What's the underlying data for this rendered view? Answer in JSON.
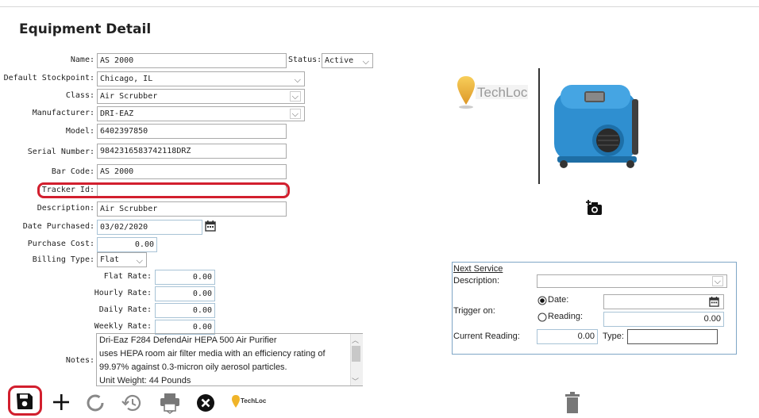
{
  "page_title": "Equipment Detail",
  "fields": {
    "name": {
      "label": "Name:",
      "value": "AS 2000"
    },
    "status": {
      "label": "Status:",
      "value": "Active"
    },
    "default_stockpoint": {
      "label": "Default Stockpoint:",
      "value": "Chicago, IL"
    },
    "class": {
      "label": "Class:",
      "value": "Air Scrubber"
    },
    "manufacturer": {
      "label": "Manufacturer:",
      "value": "DRI-EAZ"
    },
    "model": {
      "label": "Model:",
      "value": "6402397850"
    },
    "serial_number": {
      "label": "Serial Number:",
      "value": "9842316583742118DRZ"
    },
    "bar_code": {
      "label": "Bar Code:",
      "value": "AS 2000"
    },
    "tracker_id": {
      "label": "Tracker Id:",
      "value": ""
    },
    "description": {
      "label": "Description:",
      "value": "Air Scrubber"
    },
    "date_purchased": {
      "label": "Date Purchased:",
      "value": "03/02/2020"
    },
    "purchase_cost": {
      "label": "Purchase Cost:",
      "value": "0.00"
    },
    "billing_type": {
      "label": "Billing Type:",
      "value": "Flat"
    },
    "flat_rate": {
      "label": "Flat Rate:",
      "value": "0.00"
    },
    "hourly_rate": {
      "label": "Hourly Rate:",
      "value": "0.00"
    },
    "daily_rate": {
      "label": "Daily Rate:",
      "value": "0.00"
    },
    "weekly_rate": {
      "label": "Weekly Rate:",
      "value": "0.00"
    },
    "notes": {
      "label": "Notes:",
      "lines": [
        "Dri-Eaz F284 DefendAir HEPA 500 Air Purifier",
        "uses HEPA room air filter media with an efficiency rating of",
        "99.97% against 0.3-micron oily aerosol particles.",
        "Unit Weight: 44 Pounds"
      ]
    }
  },
  "next_service": {
    "title": "Next Service",
    "description_label": "Description:",
    "description_value": "",
    "trigger_label": "Trigger on:",
    "date_option": "Date:",
    "reading_option": "Reading:",
    "selected_trigger": "date",
    "date_value": "",
    "reading_value": "0.00",
    "current_reading_label": "Current Reading:",
    "current_reading_value": "0.00",
    "type_label": "Type:",
    "type_value": ""
  },
  "logo": {
    "text": "TechLoc",
    "small_text": "TechLoc"
  },
  "colors": {
    "highlight": "#d21f2e",
    "service_border": "#7fa6c6",
    "device_blue": "#2f8fd0",
    "logo_pin": "#f0b429"
  },
  "icons": {
    "save": "save-icon",
    "add": "plus-icon",
    "refresh": "refresh-icon",
    "history": "history-icon",
    "print": "print-icon",
    "cancel": "close-circle-icon",
    "camera": "camera-add-icon",
    "delete": "trash-icon",
    "calendar": "calendar-icon"
  }
}
